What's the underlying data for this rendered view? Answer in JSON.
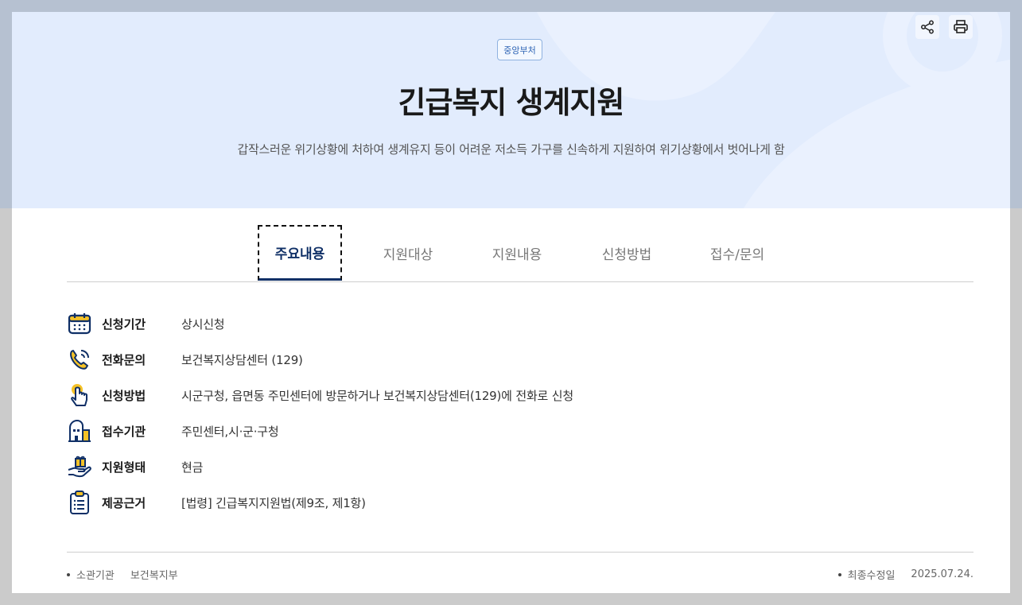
{
  "badge": "중앙부처",
  "title": "긴급복지 생계지원",
  "subtitle": "갑작스러운 위기상황에 처하여 생계유지 등이 어려운 저소득 가구를 신속하게 지원하여 위기상황에서 벗어나게 함",
  "actions": {
    "share_icon": "share-icon",
    "print_icon": "print-icon"
  },
  "tabs": [
    {
      "label": "주요내용",
      "active": true
    },
    {
      "label": "지원대상",
      "active": false
    },
    {
      "label": "지원내용",
      "active": false
    },
    {
      "label": "신청방법",
      "active": false
    },
    {
      "label": "접수/문의",
      "active": false
    }
  ],
  "info": [
    {
      "icon": "calendar-icon",
      "label": "신청기간",
      "value": "상시신청"
    },
    {
      "icon": "phone-icon",
      "label": "전화문의",
      "value": "보건복지상담센터 (129)"
    },
    {
      "icon": "hand-pointer-icon",
      "label": "신청방법",
      "value": "시군구청, 읍면동 주민센터에 방문하거나 보건복지상담센터(129)에 전화로 신청"
    },
    {
      "icon": "building-icon",
      "label": "접수기관",
      "value": "주민센터,시·군·구청"
    },
    {
      "icon": "gift-hand-icon",
      "label": "지원형태",
      "value": "현금"
    },
    {
      "icon": "clipboard-icon",
      "label": "제공근거",
      "value": "[법령] 긴급복지지원법(제9조, 제1항)"
    }
  ],
  "footer": {
    "dept_label": "소관기관",
    "dept_value": "보건복지부",
    "updated_label": "최종수정일",
    "updated_value": "2025.07.24."
  },
  "colors": {
    "navy": "#0f2f66",
    "accent_yellow": "#f5c227",
    "hero_bg": "#e2ecfd"
  }
}
